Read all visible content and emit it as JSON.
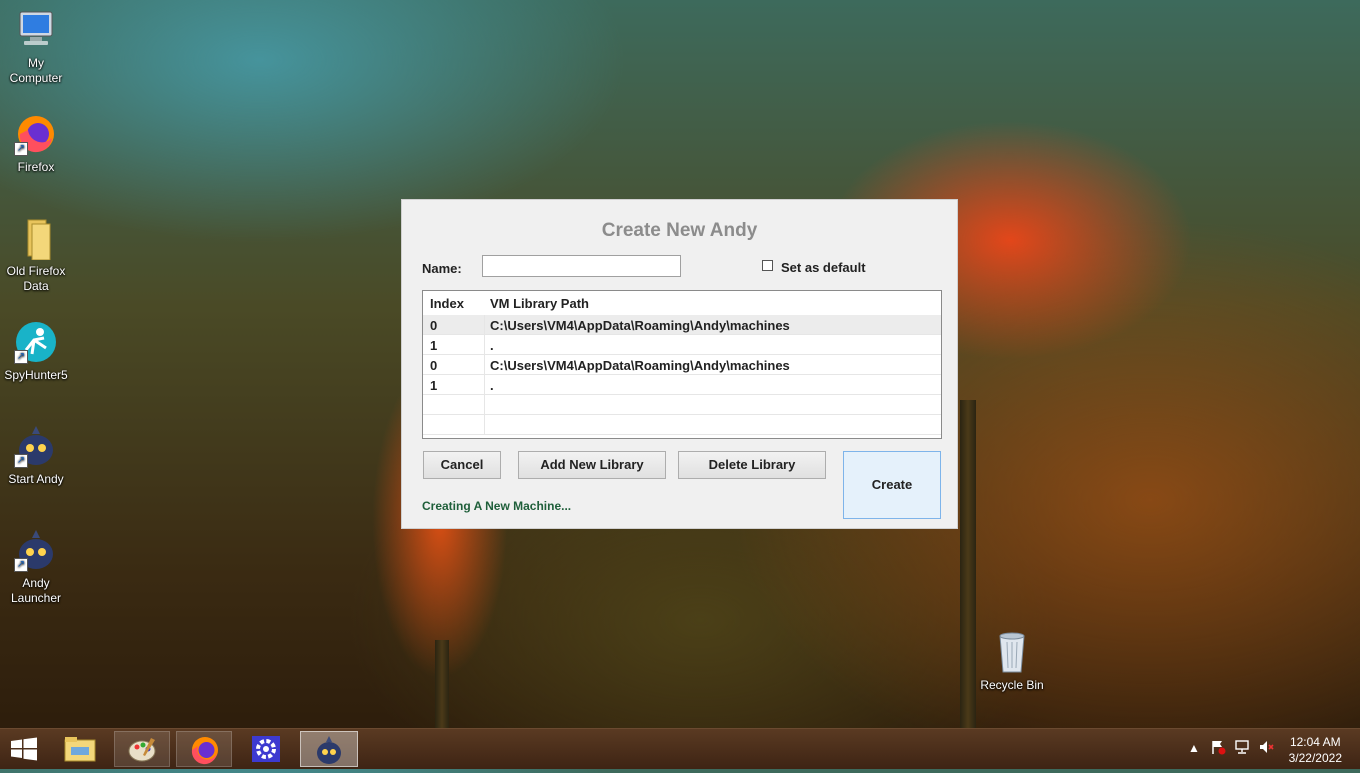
{
  "desktop": {
    "icons": [
      {
        "label": "My Computer"
      },
      {
        "label": "Firefox"
      },
      {
        "label": "Old Firefox Data"
      },
      {
        "label": "SpyHunter5"
      },
      {
        "label": "Start Andy"
      },
      {
        "label": "Andy Launcher"
      },
      {
        "label": "Recycle Bin"
      }
    ]
  },
  "dialog": {
    "title": "Create New Andy",
    "name_label": "Name:",
    "name_value": "",
    "set_default_label": "Set as default",
    "set_default_checked": false,
    "table": {
      "columns": [
        "Index",
        "VM Library Path"
      ],
      "rows": [
        {
          "index": "0",
          "path": "C:\\Users\\VM4\\AppData\\Roaming\\Andy\\machines",
          "selected": true
        },
        {
          "index": "1",
          "path": ".",
          "selected": false
        },
        {
          "index": "0",
          "path": "C:\\Users\\VM4\\AppData\\Roaming\\Andy\\machines",
          "selected": false
        },
        {
          "index": "1",
          "path": ".",
          "selected": false
        },
        {
          "index": "",
          "path": "",
          "selected": false
        },
        {
          "index": "",
          "path": "",
          "selected": false
        }
      ]
    },
    "buttons": {
      "cancel": "Cancel",
      "add_library": "Add New Library",
      "delete_library": "Delete Library",
      "create": "Create"
    },
    "status": "Creating A New Machine..."
  },
  "taskbar": {
    "apps": [
      "start-icon",
      "file-explorer-icon",
      "paint-icon",
      "firefox-icon",
      "settings-icon",
      "andy-icon"
    ],
    "clock": {
      "time": "12:04 AM",
      "date": "3/22/2022"
    }
  },
  "colors": {
    "accent": "#e5f1fb",
    "status_text": "#1f5f3a",
    "title_text": "#8c8c8c"
  }
}
